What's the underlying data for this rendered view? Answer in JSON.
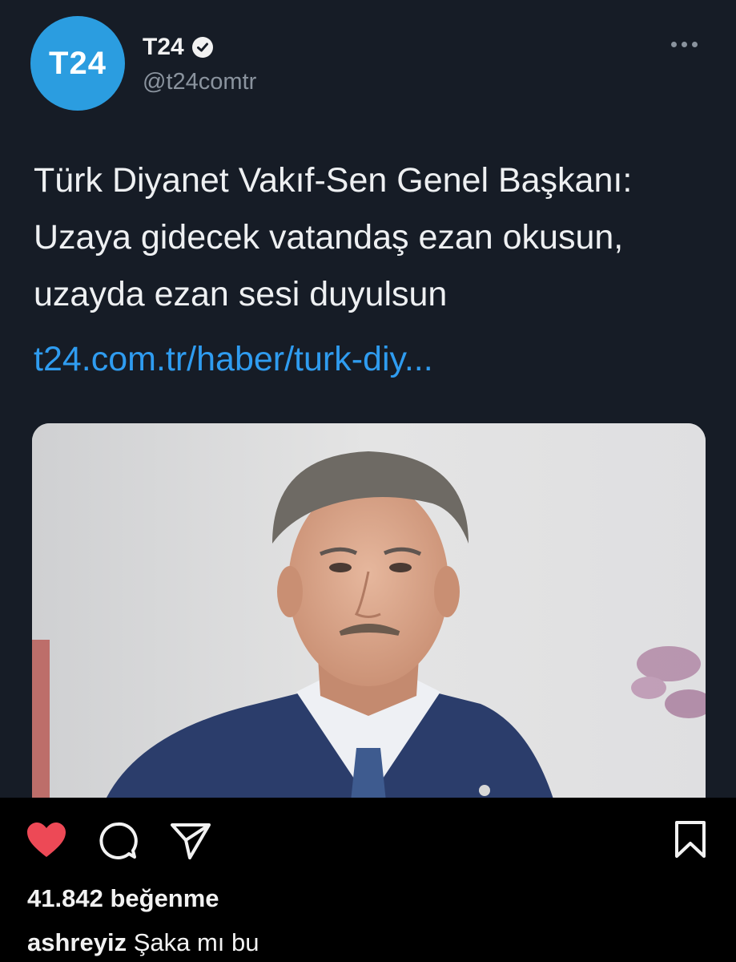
{
  "tweet": {
    "avatar_text": "T24",
    "display_name": "T24",
    "handle": "@t24comtr",
    "text_lines": [
      "Türk Diyanet Vakıf-Sen Genel Başkanı:",
      "Uzaya gidecek vatandaş ezan okusun,",
      "uzayda ezan sesi duyulsun"
    ],
    "link": "t24.com.tr/haber/turk-diy...",
    "colors": {
      "background": "#161c26",
      "avatar": "#2b9de0",
      "link": "#2f9cf0",
      "handle": "#8a939e"
    }
  },
  "post": {
    "likes_count": "41.842",
    "likes_label": "beğenme",
    "caption_user": "ashreyiz",
    "caption_text": "Şaka mı bu",
    "colors": {
      "heart": "#ed4956"
    }
  },
  "icons": {
    "verified": "verified-badge-icon",
    "more": "more-options-icon",
    "like": "heart-icon",
    "comment": "comment-icon",
    "share": "share-icon",
    "save": "bookmark-icon"
  }
}
